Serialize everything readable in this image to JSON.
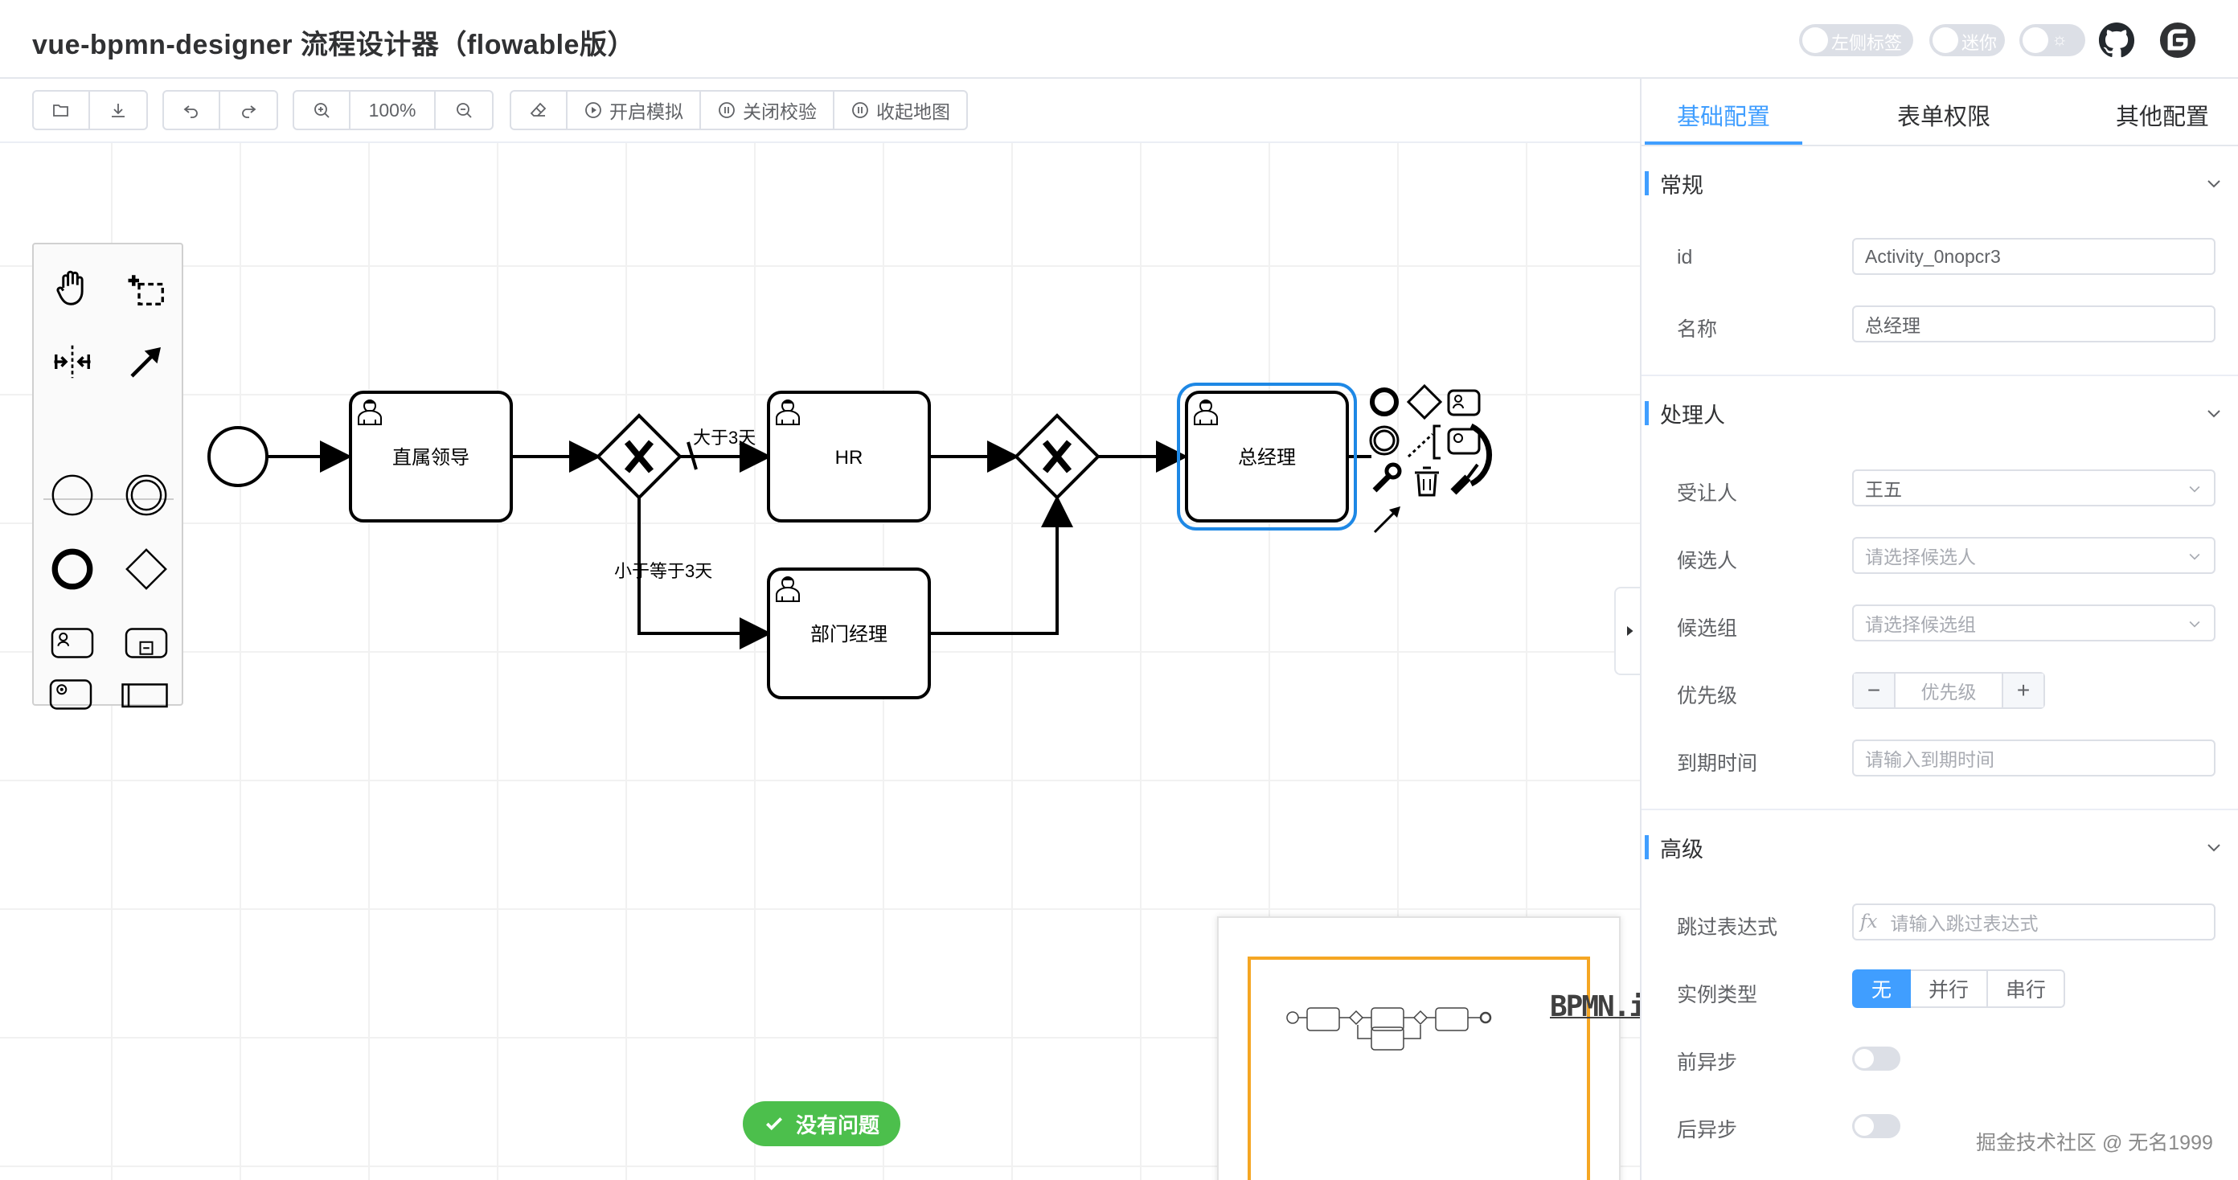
{
  "header": {
    "title": "vue-bpmn-designer 流程设计器（flowable版）",
    "switches": [
      {
        "name": "left-label-switch",
        "label": "左侧标签"
      },
      {
        "name": "mini-switch",
        "label": "迷你"
      },
      {
        "name": "theme-switch",
        "label": "☼"
      }
    ]
  },
  "toolbar": {
    "zoom": "100%",
    "simulate": "开启模拟",
    "validate": "关闭校验",
    "minimap": "收起地图"
  },
  "diagram": {
    "tasks": {
      "leader": "直属领导",
      "hr": "HR",
      "gm": "总经理",
      "dept": "部门经理"
    },
    "flows": {
      "gt3": "大于3天",
      "le3": "小于等于3天"
    }
  },
  "status": {
    "ok": "没有问题"
  },
  "logo": "BPMN.io",
  "panel": {
    "tabs": [
      "基础配置",
      "表单权限",
      "其他配置"
    ],
    "general": {
      "title": "常规",
      "id_label": "id",
      "id_value": "Activity_0nopcr3",
      "name_label": "名称",
      "name_value": "总经理"
    },
    "handler": {
      "title": "处理人",
      "assignee_label": "受让人",
      "assignee_value": "王五",
      "candidate_users_label": "候选人",
      "candidate_users_placeholder": "请选择候选人",
      "candidate_groups_label": "候选组",
      "candidate_groups_placeholder": "请选择候选组",
      "priority_label": "优先级",
      "priority_placeholder": "优先级",
      "due_label": "到期时间",
      "due_placeholder": "请输入到期时间"
    },
    "advanced": {
      "title": "高级",
      "skip_label": "跳过表达式",
      "skip_prefix": "fx",
      "skip_placeholder": "请输入跳过表达式",
      "instance_label": "实例类型",
      "instance_options": [
        "无",
        "并行",
        "串行"
      ],
      "async_before_label": "前异步",
      "async_after_label": "后异步"
    }
  },
  "watermark": "掘金技术社区 @ 无名1999",
  "colors": {
    "accent": "#409eff",
    "selection": "#1e88e5",
    "success": "#4cbf4c",
    "minimap_view": "#f5a623"
  }
}
